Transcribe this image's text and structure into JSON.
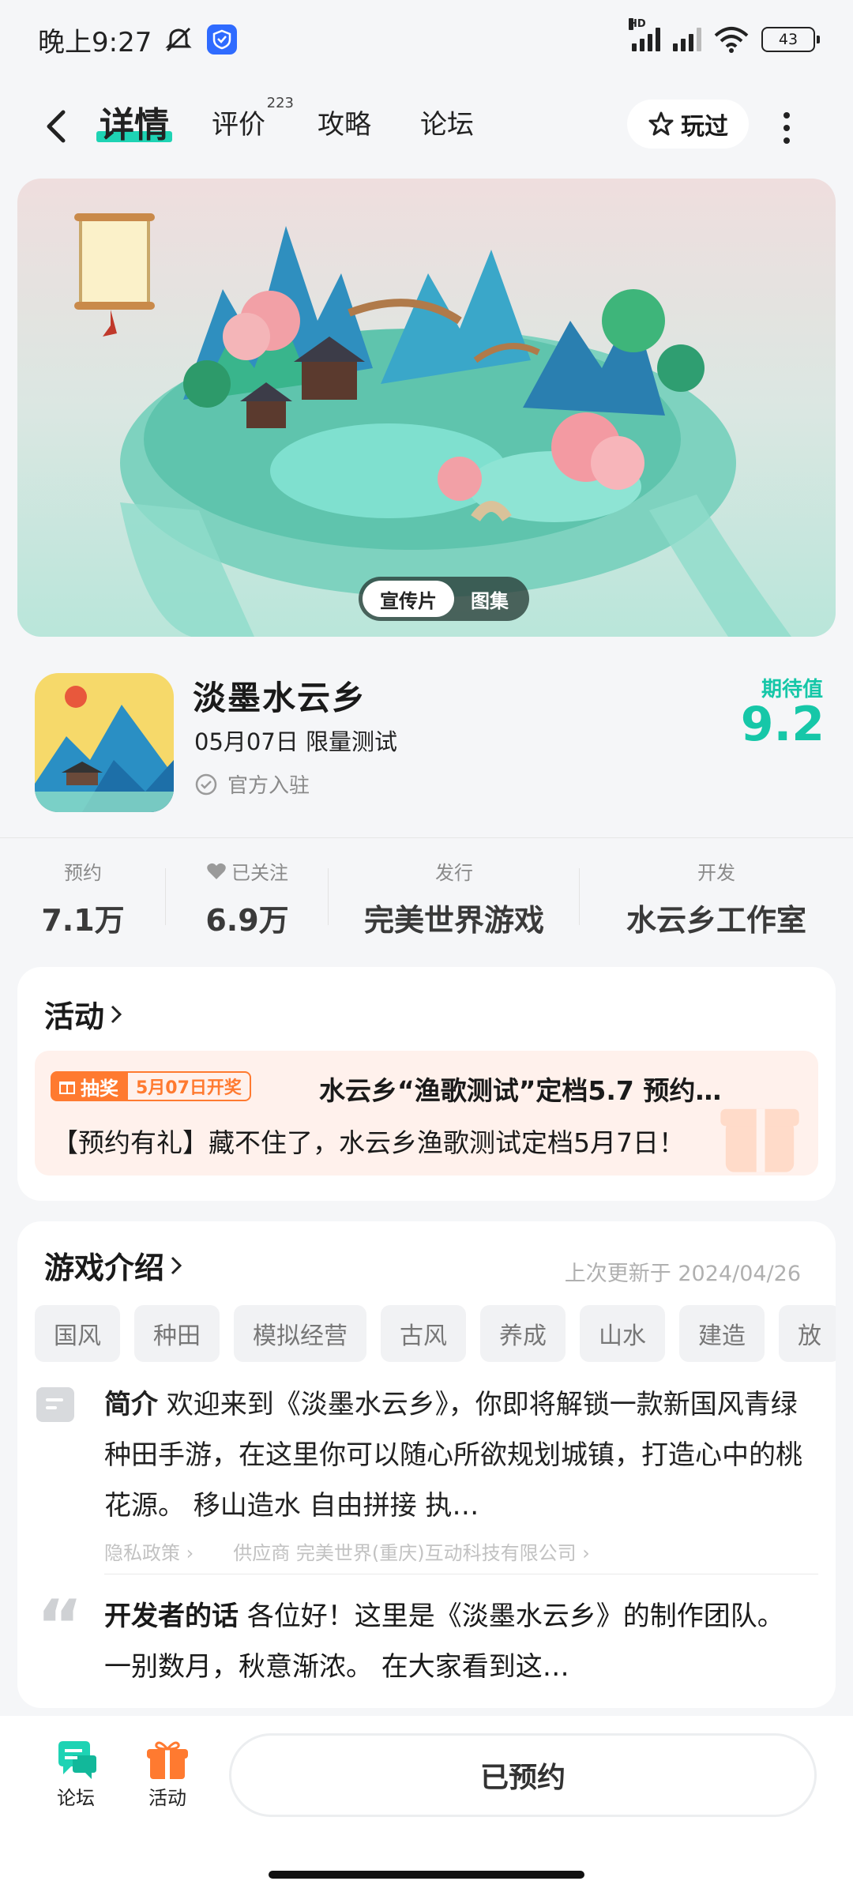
{
  "status": {
    "time": "晚上9:27",
    "network": "HD",
    "battery": "43"
  },
  "nav": {
    "tabs": [
      {
        "label": "详情",
        "active": true
      },
      {
        "label": "评价",
        "badge": "223"
      },
      {
        "label": "攻略"
      },
      {
        "label": "论坛"
      }
    ],
    "played_label": "玩过"
  },
  "banner": {
    "toggle": [
      "宣传片",
      "图集"
    ],
    "active": "宣传片"
  },
  "game": {
    "title": "淡墨水云乡",
    "date": "05月07日 限量测试",
    "official": "官方入驻",
    "expect_label": "期待值",
    "expect_value": "9.2"
  },
  "stats": [
    {
      "label": "预约",
      "value": "7.1万"
    },
    {
      "label": "已关注",
      "value": "6.9万",
      "icon": "heart-icon"
    },
    {
      "label": "发行",
      "value": "完美世界游戏"
    },
    {
      "label": "开发",
      "value": "水云乡工作室"
    }
  ],
  "activity": {
    "title": "活动",
    "tag_lottery": "抽奖",
    "tag_date": "5月07日开奖",
    "headline": "水云乡“渔歌测试”定档5.7 预约…",
    "subline": "【预约有礼】藏不住了，水云乡渔歌测试定档5月7日！"
  },
  "intro": {
    "title": "游戏介绍",
    "updated": "上次更新于 2024/04/26",
    "tags": [
      "国风",
      "种田",
      "模拟经营",
      "古风",
      "养成",
      "山水",
      "建造",
      "放"
    ],
    "summary_label": "简介",
    "summary": "欢迎来到《淡墨水云乡》，你即将解锁一款新国风青绿种田手游，在这里你可以随心所欲规划城镇，打造心中的桃花源。 移山造水 自由拼接 执…",
    "privacy": "隐私政策",
    "supplier": "供应商 完美世界(重庆)互动科技有限公司",
    "dev_label": "开发者的话",
    "dev_text": "各位好！这里是《淡墨水云乡》的制作团队。 一别数月，秋意渐浓。 在大家看到这…"
  },
  "bottom": {
    "forum": "论坛",
    "activity": "活动",
    "reserved": "已预约"
  },
  "colors": {
    "accent": "#16c7a8",
    "orange": "#ff7a30"
  }
}
